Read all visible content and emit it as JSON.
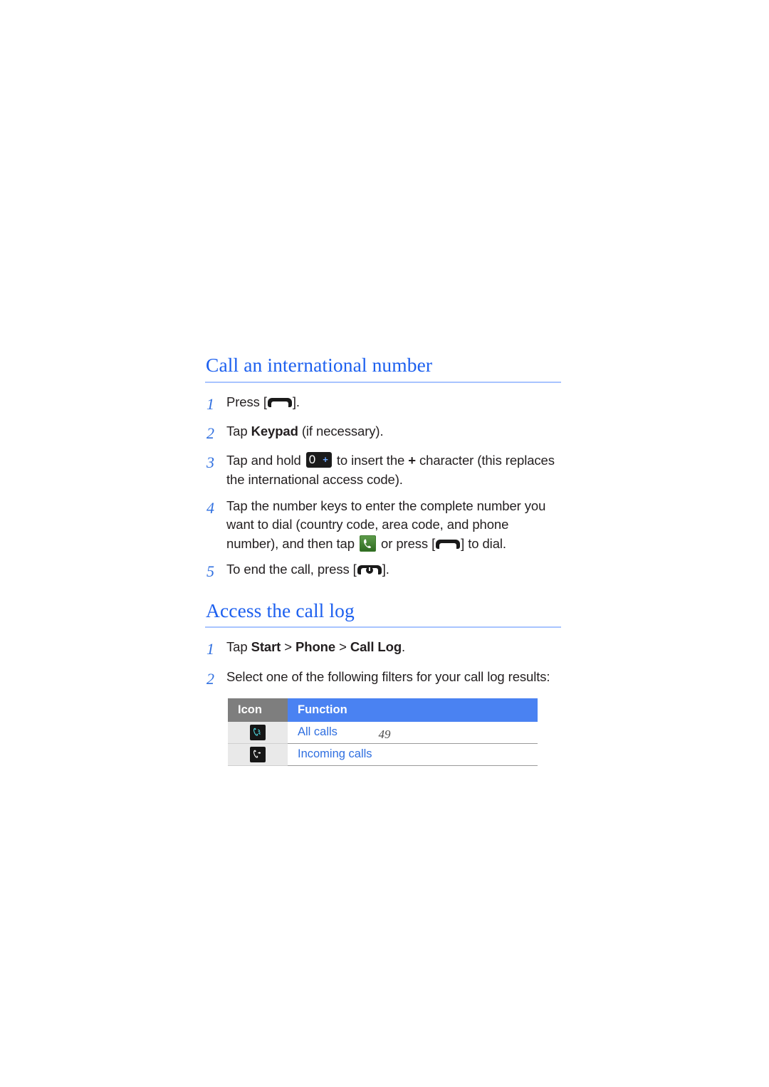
{
  "document": {
    "page_number": "49"
  },
  "sections": [
    {
      "heading": "Call an international number",
      "steps": [
        {
          "number": "1",
          "text_before": "Press [",
          "icon": "send-key-icon",
          "text_after": "]."
        },
        {
          "number": "2",
          "prefix": "Tap ",
          "bold": "Keypad",
          "suffix": " (if necessary)."
        },
        {
          "number": "3",
          "p1": "Tap and hold ",
          "icon": "zero-plus-key-icon",
          "p2": " to insert the ",
          "bold": "+",
          "p3": " character (this replaces the international access code)."
        },
        {
          "number": "4",
          "p1": "Tap the number keys to enter the complete number you want to dial (country code, area code, and phone number), and then tap ",
          "icon": "dial-button-icon",
          "p2": " or press [",
          "icon2": "send-key-icon",
          "p3": "] to dial."
        },
        {
          "number": "5",
          "p1": "To end the call, press [",
          "icon": "end-key-icon",
          "p2": "]."
        }
      ]
    },
    {
      "heading": "Access the call log",
      "steps": [
        {
          "number": "1",
          "p1": "Tap ",
          "b1": "Start",
          "g1": " > ",
          "b2": "Phone",
          "g2": " > ",
          "b3": "Call Log",
          "p2": "."
        },
        {
          "number": "2",
          "p1": "Select one of the following filters for your call log results:"
        }
      ]
    }
  ],
  "filters_table": {
    "headers": {
      "icon": "Icon",
      "function": "Function"
    },
    "rows": [
      {
        "icon_name": "all-calls-icon",
        "function": "All calls"
      },
      {
        "icon_name": "incoming-calls-icon",
        "function": "Incoming calls"
      }
    ]
  },
  "colors": {
    "heading_blue": "#1d60ef",
    "step_number_blue": "#2f6fe0",
    "rule_blue": "#a8c4ff",
    "table_header_blue": "#4a82f2",
    "table_header_gray": "#7e7e7e",
    "link_blue": "#2f6fe0",
    "body_text": "#231f20"
  }
}
